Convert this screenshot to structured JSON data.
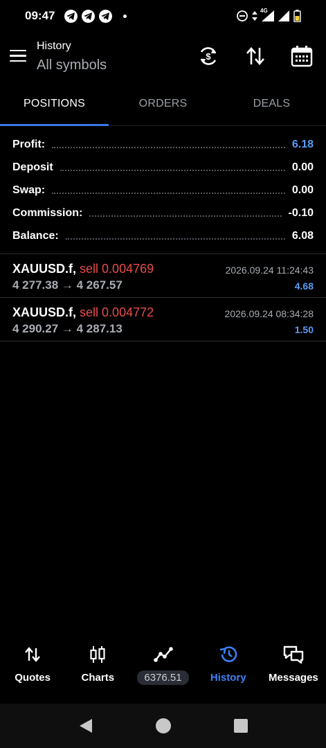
{
  "status_bar": {
    "time": "09:47",
    "network": "4G"
  },
  "header": {
    "title": "History",
    "subtitle": "All symbols"
  },
  "tabs": [
    {
      "label": "POSITIONS",
      "active": true
    },
    {
      "label": "ORDERS",
      "active": false
    },
    {
      "label": "DEALS",
      "active": false
    }
  ],
  "summary": {
    "profit": {
      "label": "Profit:",
      "value": "6.18"
    },
    "deposit": {
      "label": "Deposit",
      "value": "0.00"
    },
    "swap": {
      "label": "Swap:",
      "value": "0.00"
    },
    "commission": {
      "label": "Commission:",
      "value": "-0.10"
    },
    "balance": {
      "label": "Balance:",
      "value": "6.08"
    }
  },
  "positions": [
    {
      "symbol": "XAUUSD.f,",
      "side": "sell 0.004769",
      "prices": "4 277.38 → 4 267.57",
      "time": "2026.09.24 11:24:43",
      "profit": "4.68"
    },
    {
      "symbol": "XAUUSD.f,",
      "side": "sell 0.004772",
      "prices": "4 290.27 → 4 287.13",
      "time": "2026.09.24 08:34:28",
      "profit": "1.50"
    }
  ],
  "bottom_nav": {
    "quotes": "Quotes",
    "charts": "Charts",
    "equity": "6376.51",
    "history": "History",
    "messages": "Messages"
  },
  "colors": {
    "accent": "#3b78e7",
    "profit_blue": "#5b9cf5",
    "sell_red": "#e84c4c",
    "background": "#000000"
  }
}
